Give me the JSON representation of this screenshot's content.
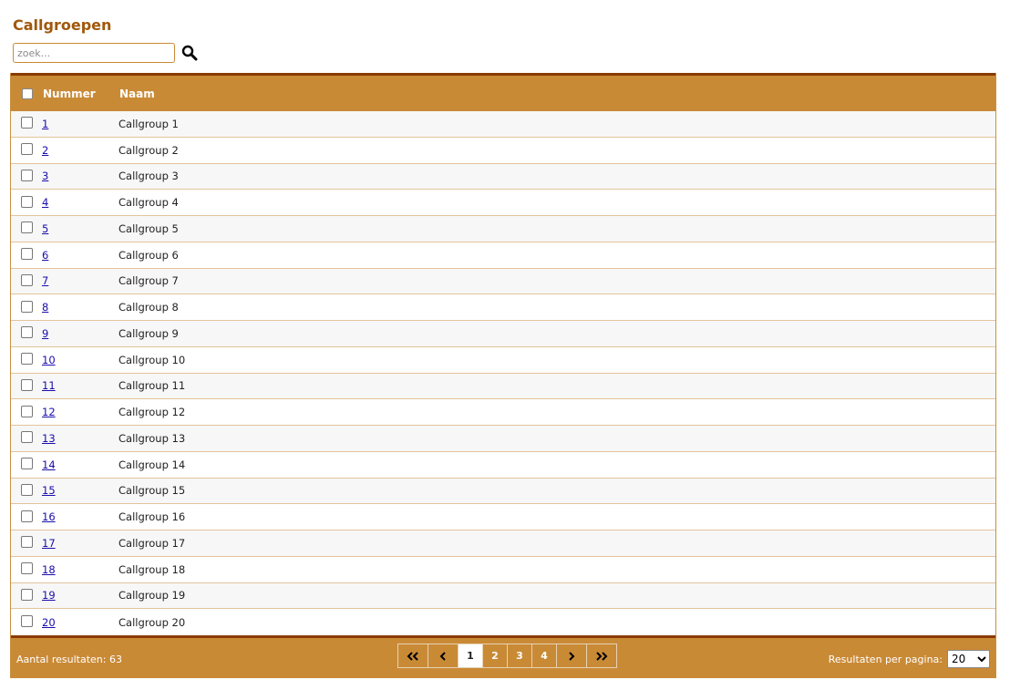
{
  "page": {
    "title": "Callgroepen"
  },
  "search": {
    "placeholder": "zoek..."
  },
  "table": {
    "columns": {
      "number": "Nummer",
      "name": "Naam"
    },
    "rows": [
      {
        "number": "1",
        "name": "Callgroup 1"
      },
      {
        "number": "2",
        "name": "Callgroup 2"
      },
      {
        "number": "3",
        "name": "Callgroup 3"
      },
      {
        "number": "4",
        "name": "Callgroup 4"
      },
      {
        "number": "5",
        "name": "Callgroup 5"
      },
      {
        "number": "6",
        "name": "Callgroup 6"
      },
      {
        "number": "7",
        "name": "Callgroup 7"
      },
      {
        "number": "8",
        "name": "Callgroup 8"
      },
      {
        "number": "9",
        "name": "Callgroup 9"
      },
      {
        "number": "10",
        "name": "Callgroup 10"
      },
      {
        "number": "11",
        "name": "Callgroup 11"
      },
      {
        "number": "12",
        "name": "Callgroup 12"
      },
      {
        "number": "13",
        "name": "Callgroup 13"
      },
      {
        "number": "14",
        "name": "Callgroup 14"
      },
      {
        "number": "15",
        "name": "Callgroup 15"
      },
      {
        "number": "16",
        "name": "Callgroup 16"
      },
      {
        "number": "17",
        "name": "Callgroup 17"
      },
      {
        "number": "18",
        "name": "Callgroup 18"
      },
      {
        "number": "19",
        "name": "Callgroup 19"
      },
      {
        "number": "20",
        "name": "Callgroup 20"
      }
    ]
  },
  "footer": {
    "result_count": "Aantal resultaten: 63",
    "pages": [
      "1",
      "2",
      "3",
      "4"
    ],
    "current_page": "1",
    "per_page_label": "Resultaten per pagina:",
    "per_page_value": "20"
  },
  "colors": {
    "accent": "#c98a36",
    "accent_dark": "#8a3a00",
    "title": "#a0580b",
    "link": "#1a0dab"
  },
  "icons": {
    "search": "search-icon",
    "first": "first-page-icon",
    "prev": "prev-page-icon",
    "next": "next-page-icon",
    "last": "last-page-icon"
  }
}
